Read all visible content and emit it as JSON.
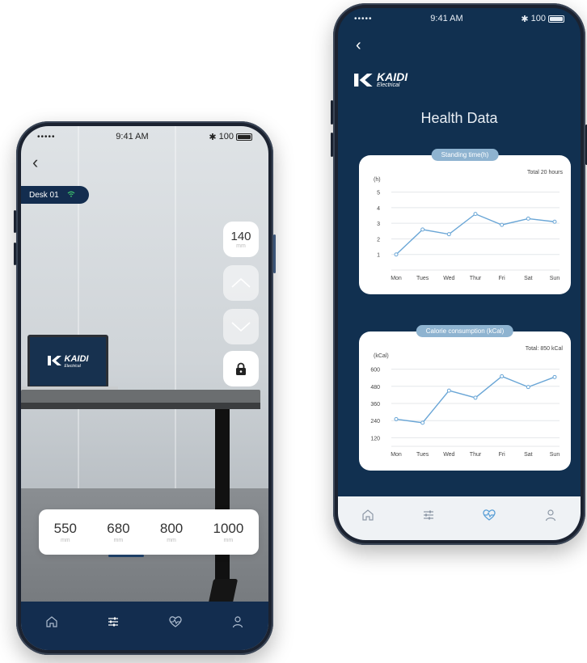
{
  "status": {
    "time": "9:41 AM",
    "signal": "•••••",
    "battery": "100"
  },
  "colors": {
    "navy": "#132d4f",
    "accent_blue": "#8eb3d0",
    "line_blue": "#6aa6d6",
    "online_green": "#3ec46d"
  },
  "icons": {
    "home": "home-icon",
    "controls": "sliders-icon",
    "health": "heart-pulse-icon",
    "profile": "user-icon",
    "lock": "lock-icon"
  },
  "desk_screen": {
    "desk_label": "Desk 01",
    "laptop_brand": "KAIDI",
    "laptop_brand_sub": "Electrical",
    "current_height": "140",
    "presets": [
      {
        "value": "550",
        "unit": "mm"
      },
      {
        "value": "680",
        "unit": "mm"
      },
      {
        "value": "800",
        "unit": "mm"
      },
      {
        "value": "1000",
        "unit": "mm"
      }
    ],
    "selected_preset": 1
  },
  "health_screen": {
    "brand": "KAIDI",
    "brand_sub": "Electrical",
    "title": "Health Data",
    "standing": {
      "pill": "Standing time(h)",
      "total": "Total 20 hours"
    },
    "calorie": {
      "pill": "Calorie consumption (kCal)",
      "total": "Total: 850 kCal"
    }
  },
  "chart_data": [
    {
      "type": "line",
      "title": "Standing time(h)",
      "ylabel": "(h)",
      "categories": [
        "Mon",
        "Tues",
        "Wed",
        "Thur",
        "Fri",
        "Sat",
        "Sun"
      ],
      "values": [
        1,
        2.6,
        2.3,
        3.6,
        2.9,
        3.3,
        3.1
      ],
      "yticks": [
        1,
        2,
        3,
        4,
        5
      ],
      "ylim": [
        0,
        5.5
      ],
      "grid": true
    },
    {
      "type": "line",
      "title": "Calorie consumption (kCal)",
      "ylabel": "(kCal)",
      "categories": [
        "Mon",
        "Tues",
        "Wed",
        "Thur",
        "Fri",
        "Sat",
        "Sun"
      ],
      "values": [
        250,
        225,
        450,
        400,
        550,
        475,
        545
      ],
      "yticks": [
        120,
        240,
        360,
        480,
        600
      ],
      "ylim": [
        60,
        660
      ],
      "grid": true
    }
  ]
}
